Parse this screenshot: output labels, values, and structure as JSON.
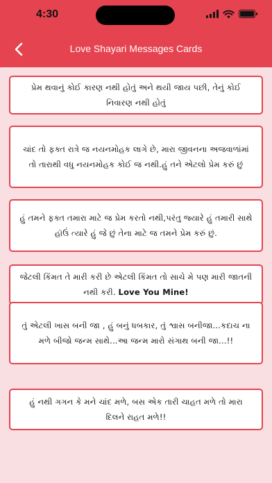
{
  "status_bar": {
    "time": "4:30"
  },
  "header": {
    "title": "Love Shayari Messages Cards"
  },
  "icons": {
    "back": "chevron-left-icon",
    "signal": "signal-icon",
    "wifi": "wifi-icon",
    "battery": "battery-icon"
  },
  "colors": {
    "accent": "#e5434f",
    "background": "#f9dfe2",
    "card": "#ffffff"
  },
  "cards": [
    {
      "text": "પ્રેમ થવાનું કોઈ કારણ નથી હોતું અને થયી જાય પછી, તેનું કોઈ નિવારણ નથી હોતું"
    },
    {
      "text": "ચાંદ તો ફક્ત રાત્રે જ નયનમોહક લાગે છે, મારા જીવનના અજવાળાંમાં તો તારાથી વધુ નયનમોહક કોઈ જ નથી.હું તને એટલો પ્રેમ કરું છું"
    },
    {
      "text": "હું તમને ફક્ત તમારા માટે જ પ્રેમ કરતો નથી,પરંતુ જ્યારે હું તમારી સાથે હૉઉં ત્યારે હું જે છું તેના માટે જ તમને પ્રેમ કરું છું."
    },
    {
      "text": "જેટલી કિંમત તે મારી કરી છે એટલી કિંમત તો સાચે મે પણ મારી જાતની નથી કરી.",
      "bold": "Love You Mine!"
    },
    {
      "text": "તું એટલી ખાસ બની જા , હું બનું ધબકાર, તું શ્વાસ બનીજા...કદાચ ના મળે બીજો જન્મ સાથે...આ જન્મ મારો સંગાથ બની જા...!!"
    },
    {
      "text": "હું નથી ગગન કે મને ચાંદ મળે, બસ એક તારી ચાહત મળે તો મારા દિલને રાહત મળે!!"
    }
  ]
}
